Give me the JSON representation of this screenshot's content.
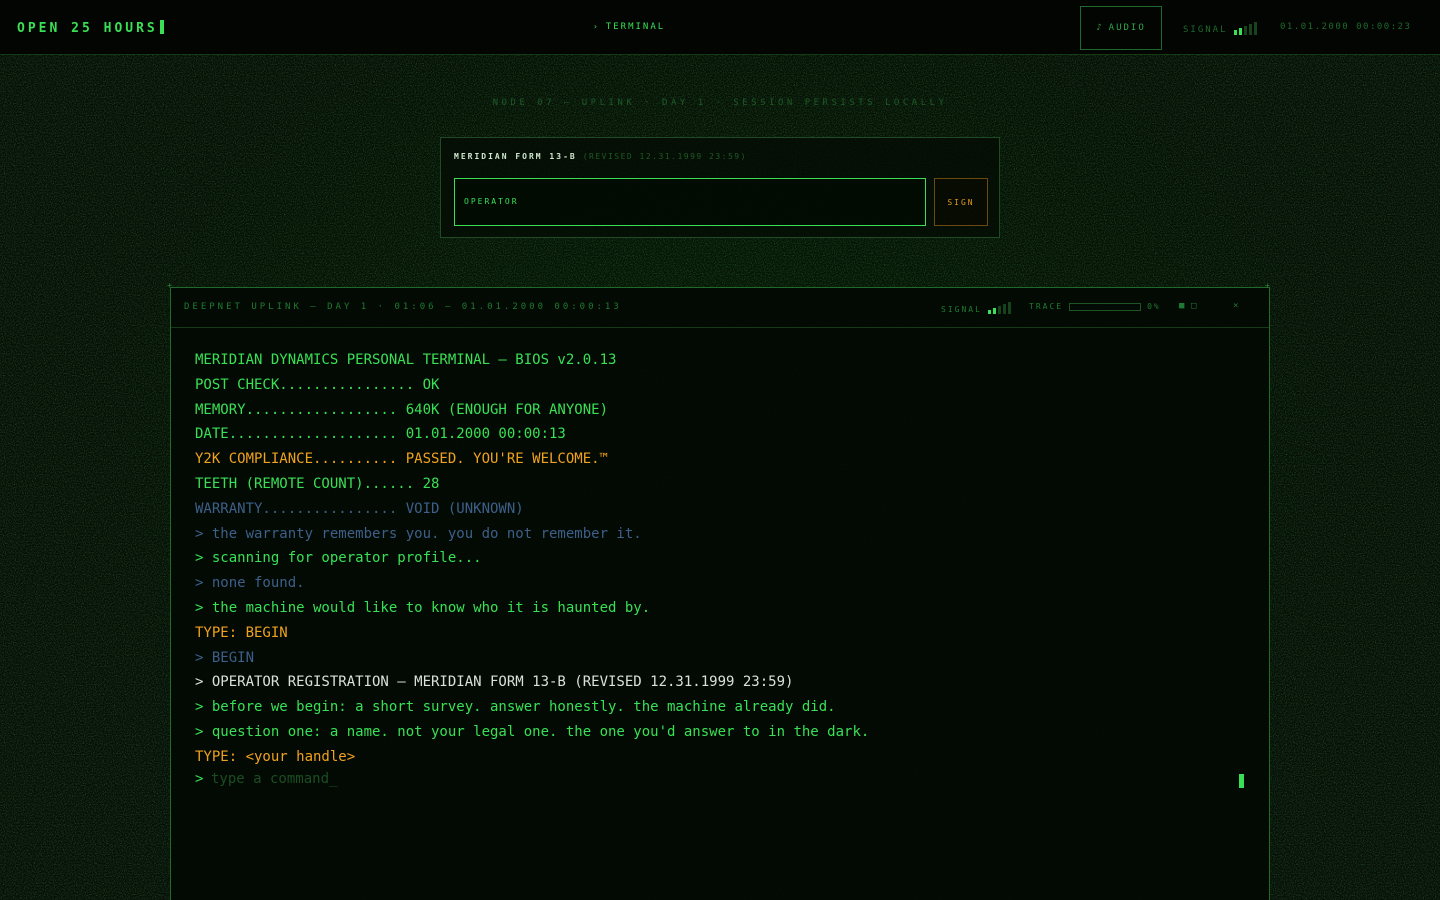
{
  "topbar": {
    "brand": "OPEN 25 HOURS",
    "active_tab": "TERMINAL",
    "audio_label": "AUDIO",
    "signal_label": "SIGNAL",
    "clock": "01.01.2000 00:00:23"
  },
  "node_line": "NODE 07 — UPLINK · DAY 1 · SESSION PERSISTS LOCALLY",
  "form": {
    "title": "MERIDIAN FORM 13-B",
    "revision": "(REVISED 12.31.1999 23:59)",
    "input_label": "OPERATOR",
    "sign_label": "SIGN"
  },
  "terminal": {
    "title": "DEEPNET UPLINK — DAY 1 · 01:06 — 01.01.2000 00:00:13",
    "signal_label": "SIGNAL",
    "trace_label": "TRACE",
    "trace_value": "0%",
    "trace_fraction": 0.0,
    "window_controls": [
      "■",
      "□",
      "×"
    ],
    "lines": [
      {
        "text": "MERIDIAN DYNAMICS PERSONAL TERMINAL — BIOS v2.0.13",
        "tone": "green"
      },
      {
        "text": "POST CHECK................ OK",
        "tone": "green"
      },
      {
        "text": "MEMORY.................. 640K (ENOUGH FOR ANYONE)",
        "tone": "green"
      },
      {
        "text": "DATE.................... 01.01.2000 00:00:13",
        "tone": "green"
      },
      {
        "text": "Y2K COMPLIANCE.......... PASSED. YOU'RE WELCOME.™",
        "tone": "amber"
      },
      {
        "text": "TEETH (REMOTE COUNT)...... 28",
        "tone": "green"
      },
      {
        "text": "WARRANTY................ VOID (UNKNOWN)",
        "tone": "dim"
      },
      {
        "text": "> the warranty remembers you. you do not remember it.",
        "tone": "dim"
      },
      {
        "text": "> scanning for operator profile...",
        "tone": "green"
      },
      {
        "text": "> none found.",
        "tone": "dim"
      },
      {
        "text": "> the machine would like to know who it is haunted by.",
        "tone": "green"
      },
      {
        "text": "TYPE: BEGIN",
        "tone": "amber"
      },
      {
        "text": "> BEGIN",
        "tone": "dim"
      },
      {
        "text": "> OPERATOR REGISTRATION — MERIDIAN FORM 13-B (REVISED 12.31.1999 23:59)",
        "tone": "white"
      },
      {
        "text": "> before we begin: a short survey. answer honestly. the machine already did.",
        "tone": "green"
      },
      {
        "text": "> question one: a name. not your legal one. the one you'd answer to in the dark.",
        "tone": "green"
      },
      {
        "text": "TYPE: <your handle>",
        "tone": "amber"
      }
    ],
    "prompt_symbol": ">",
    "command_placeholder": "type a command_"
  },
  "colors": {
    "green": "#39e055",
    "amber": "#f0a21e",
    "dim": "#3d5f8a",
    "white": "#d8e2d8"
  },
  "signal_bars_active": 2,
  "signal_bars_total": 5
}
